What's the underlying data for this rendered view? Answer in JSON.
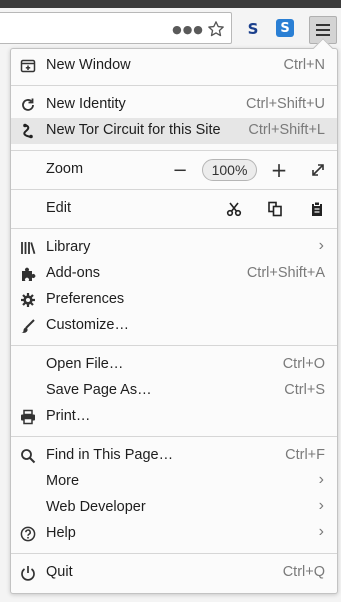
{
  "toolbar": {
    "overflow_icon": "ellipsis-icon",
    "bookmark_icon": "star-icon",
    "ext1_letter": "S",
    "ext2_letter": "S",
    "menu_icon": "hamburger-icon"
  },
  "menu": {
    "new_window": {
      "label": "New Window",
      "shortcut": "Ctrl+N"
    },
    "new_identity": {
      "label": "New Identity",
      "shortcut": "Ctrl+Shift+U"
    },
    "new_circuit": {
      "label": "New Tor Circuit for this Site",
      "shortcut": "Ctrl+Shift+L"
    },
    "zoom": {
      "label": "Zoom",
      "minus": "−",
      "level": "100%",
      "plus": "+"
    },
    "edit": {
      "label": "Edit"
    },
    "library": {
      "label": "Library",
      "chevron": "›"
    },
    "addons": {
      "label": "Add-ons",
      "shortcut": "Ctrl+Shift+A"
    },
    "preferences": {
      "label": "Preferences"
    },
    "customize": {
      "label": "Customize…"
    },
    "open_file": {
      "label": "Open File…",
      "shortcut": "Ctrl+O"
    },
    "save_page": {
      "label": "Save Page As…",
      "shortcut": "Ctrl+S"
    },
    "print": {
      "label": "Print…"
    },
    "find": {
      "label": "Find in This Page…",
      "shortcut": "Ctrl+F"
    },
    "more": {
      "label": "More",
      "chevron": "›"
    },
    "web_developer": {
      "label": "Web Developer",
      "chevron": "›"
    },
    "help": {
      "label": "Help",
      "chevron": "›"
    },
    "quit": {
      "label": "Quit",
      "shortcut": "Ctrl+Q"
    }
  },
  "colors": {
    "hover_bg": "#e6e6e6",
    "ext2_bg": "#2a7fd4",
    "ext1_fg": "#1a3f8c"
  }
}
